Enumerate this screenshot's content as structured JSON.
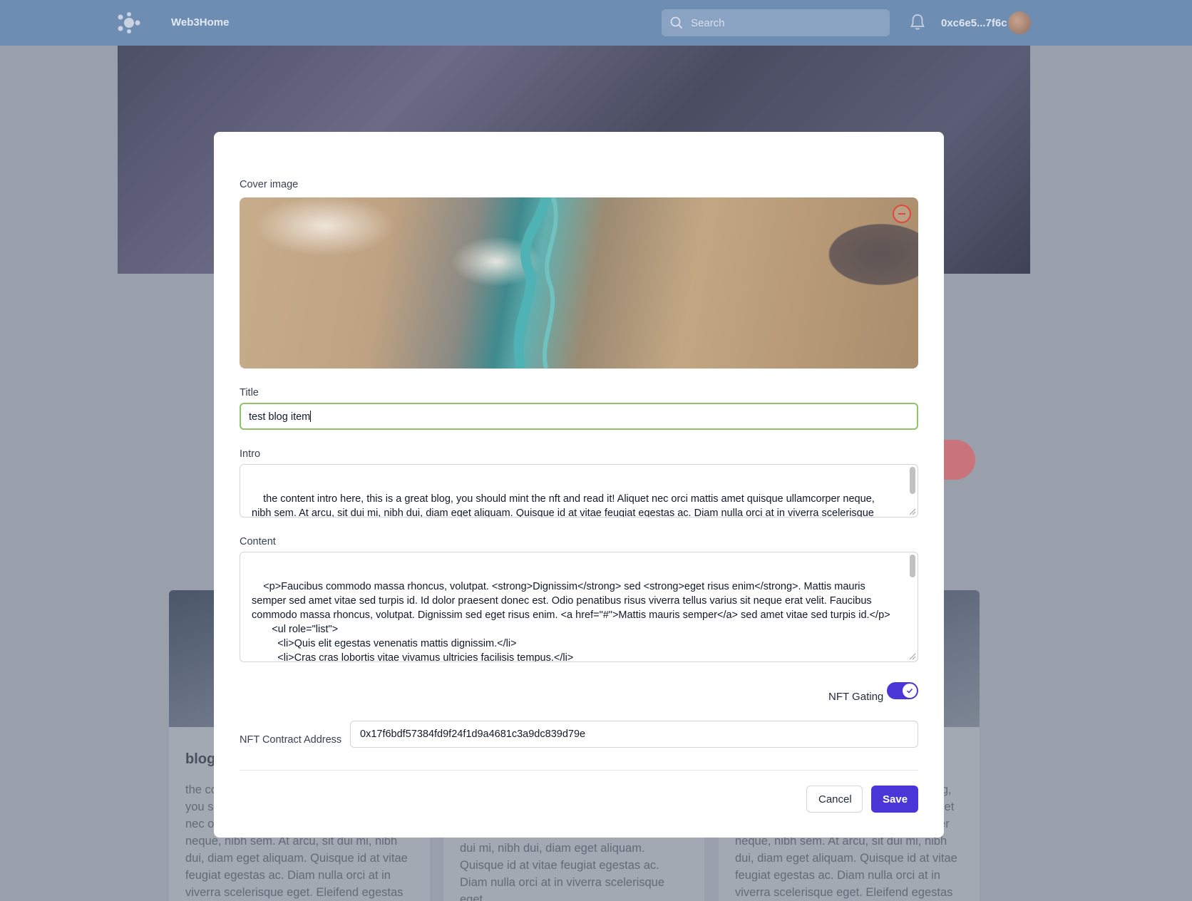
{
  "header": {
    "brand": "Web3Home",
    "search_placeholder": "Search",
    "wallet": "0xc6e5...7f6c"
  },
  "background_cards": [
    {
      "title": "blog",
      "text": "the content intro here, this is a great blog, you should mint the nft and read it! Aliquet nec orci mattis amet quisque ullamcorper neque, nibh sem. At arcu, sit dui mi, nibh dui, diam eget aliquam. Quisque id at vitae feugiat egestas ac. Diam nulla orci at in viverra scelerisque eget. Eleifend egestas"
    },
    {
      "title": "",
      "text": "ullamcorper neque, nibh sem. At arcu, sit dui mi, nibh dui, diam eget aliquam. Quisque id at vitae feugiat egestas ac. Diam nulla orci at in viverra scelerisque eget."
    },
    {
      "title": "",
      "text": "the content intro here, this is a great blog, you should mint the nft and read it! Aliquet nec orci mattis amet quisque ullamcorper neque, nibh sem. At arcu, sit dui mi, nibh dui, diam eget aliquam. Quisque id at vitae feugiat egestas ac. Diam nulla orci at in viverra scelerisque eget. Eleifend egestas"
    }
  ],
  "modal": {
    "cover_label": "Cover image",
    "title_label": "Title",
    "title_value": "test blog item",
    "intro_label": "Intro",
    "intro_value": "the content intro here, this is a great blog, you should mint the nft and read it! Aliquet nec orci mattis amet quisque ullamcorper neque, nibh sem. At arcu, sit dui mi, nibh dui, diam eget aliquam. Quisque id at vitae feugiat egestas ac. Diam nulla orci at in viverra scelerisque eget. Eleifend egestas fringilla sapien.",
    "content_label": "Content",
    "content_value": "<p>Faucibus commodo massa rhoncus, volutpat. <strong>Dignissim</strong> sed <strong>eget risus enim</strong>. Mattis mauris semper sed amet vitae sed turpis id. Id dolor praesent donec est. Odio penatibus risus viverra tellus varius sit neque erat velit. Faucibus commodo massa rhoncus, volutpat. Dignissim sed eget risus enim. <a href=\"#\">Mattis mauris semper</a> sed amet vitae sed turpis id.</p>\n       <ul role=\"list\">\n         <li>Quis elit egestas venenatis mattis dignissim.</li>\n         <li>Cras cras lobortis vitae vivamus ultricies facilisis tempus.</li>\n         <li>Orci in sit morbi dignissim metus diam arcu pretium.</li>",
    "nft_gating_label": "NFT Gating",
    "nft_gating_on": true,
    "contract_label": "NFT Contract Address",
    "contract_value": "0x17f6bdf57384fd9f24f1d9a4681c3a9dc839d79e",
    "cancel_label": "Cancel",
    "save_label": "Save"
  },
  "colors": {
    "accent": "#4a35d6",
    "title_focus_border": "#8cc56a",
    "remove_icon": "#e1473d"
  }
}
